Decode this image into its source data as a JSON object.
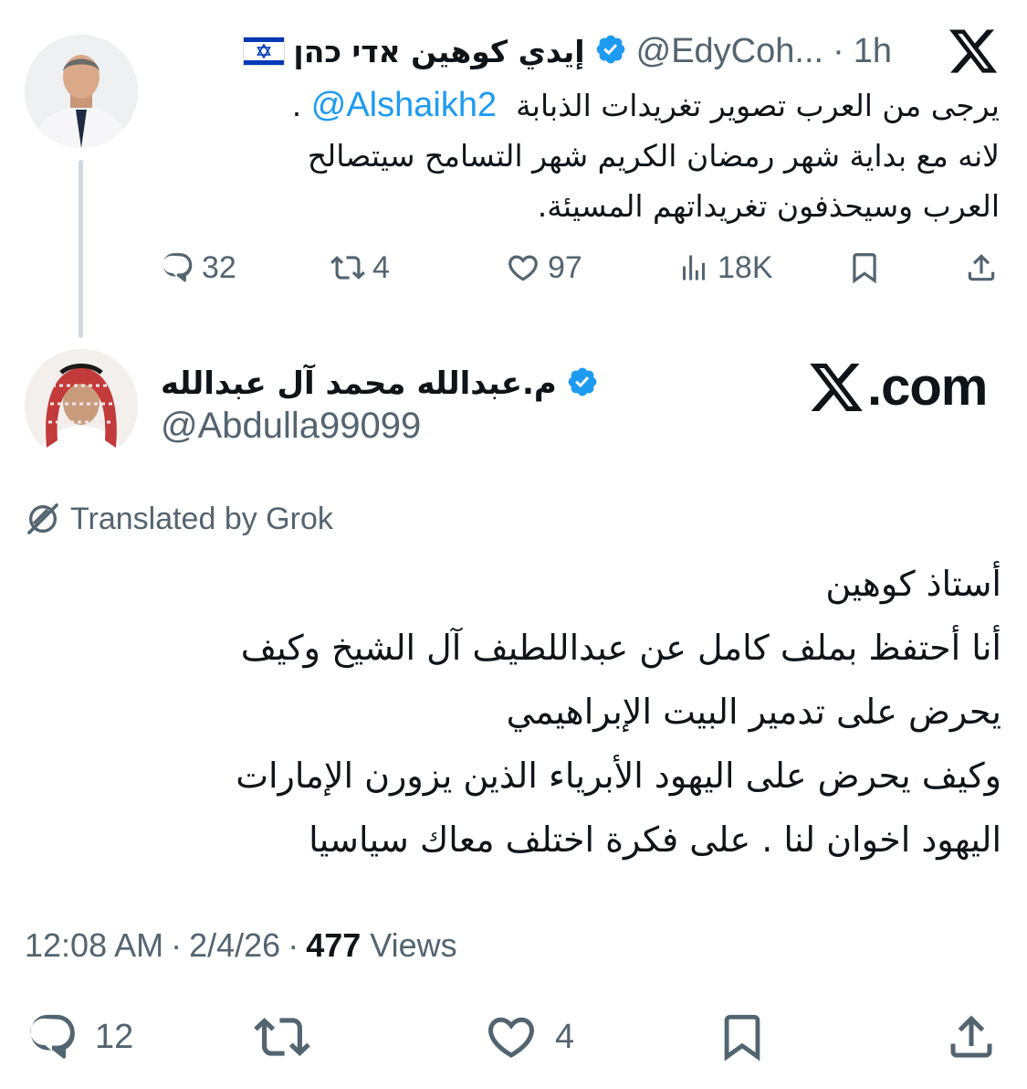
{
  "parent_tweet": {
    "author_name": "إيدي كوهين אדי כהן",
    "flag": "israel-flag",
    "handle": "@EdyCoh...",
    "separator": "·",
    "time_ago": "1h",
    "text_line1_prefix": "يرجى من العرب تصوير تغريدات الذبابة",
    "mention": "@Alshaikh2",
    "text_line1_suffix": ".",
    "text_line2": "لانه مع بداية شهر رمضان الكريم شهر التسامح سيتصالح",
    "text_line3": "العرب وسيحذفون تغريداتهم المسيئة.",
    "replies": "32",
    "reposts": "4",
    "likes": "97",
    "views": "18K",
    "verified_color": "#1d9bf0"
  },
  "main_tweet": {
    "author_name": "م.عبدالله محمد آل عبدالله",
    "handle": "@Abdulla99099",
    "watermark": ".com",
    "translated_label": "Translated by Grok",
    "lines": [
      "أستاذ كوهين",
      "أنا أحتفظ بملف كامل عن عبداللطيف آل الشيخ وكيف",
      "يحرض على تدمير البيت الإبراهيمي",
      "وكيف يحرض على اليهود الأبرياء الذين يزورن الإمارات",
      "اليهود اخوان لنا . على فكرة اختلف معاك سياسيا"
    ],
    "time": "12:08 AM",
    "date": "2/4/26",
    "dot": "·",
    "views_count": "477",
    "views_label": "Views",
    "replies": "12",
    "likes": "4"
  },
  "colors": {
    "text": "#0f1419",
    "secondary": "#536471",
    "link": "#1d9bf0",
    "thread_line": "#cfd9de"
  }
}
